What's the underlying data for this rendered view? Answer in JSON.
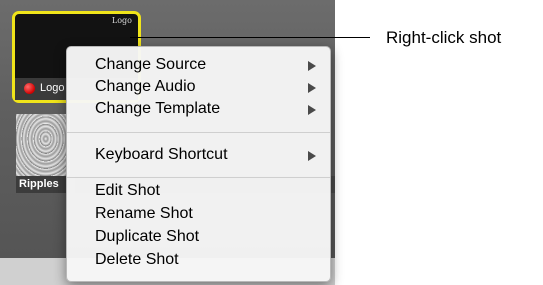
{
  "shot": {
    "title_overlay": "Logo",
    "label": "Logo"
  },
  "ripple": {
    "label": "Ripples"
  },
  "context_menu": {
    "items": [
      {
        "label": "Change Source",
        "has_submenu": true
      },
      {
        "label": "Change Audio",
        "has_submenu": true
      },
      {
        "label": "Change Template",
        "has_submenu": true
      },
      {
        "label": "Keyboard Shortcut",
        "has_submenu": true
      },
      {
        "label": "Edit Shot",
        "has_submenu": false
      },
      {
        "label": "Rename Shot",
        "has_submenu": false
      },
      {
        "label": "Duplicate Shot",
        "has_submenu": false
      },
      {
        "label": "Delete Shot",
        "has_submenu": false
      }
    ]
  },
  "callout": {
    "text": "Right-click shot"
  },
  "colors": {
    "selection_border": "#f0e41a",
    "live_indicator": "#d00000"
  }
}
